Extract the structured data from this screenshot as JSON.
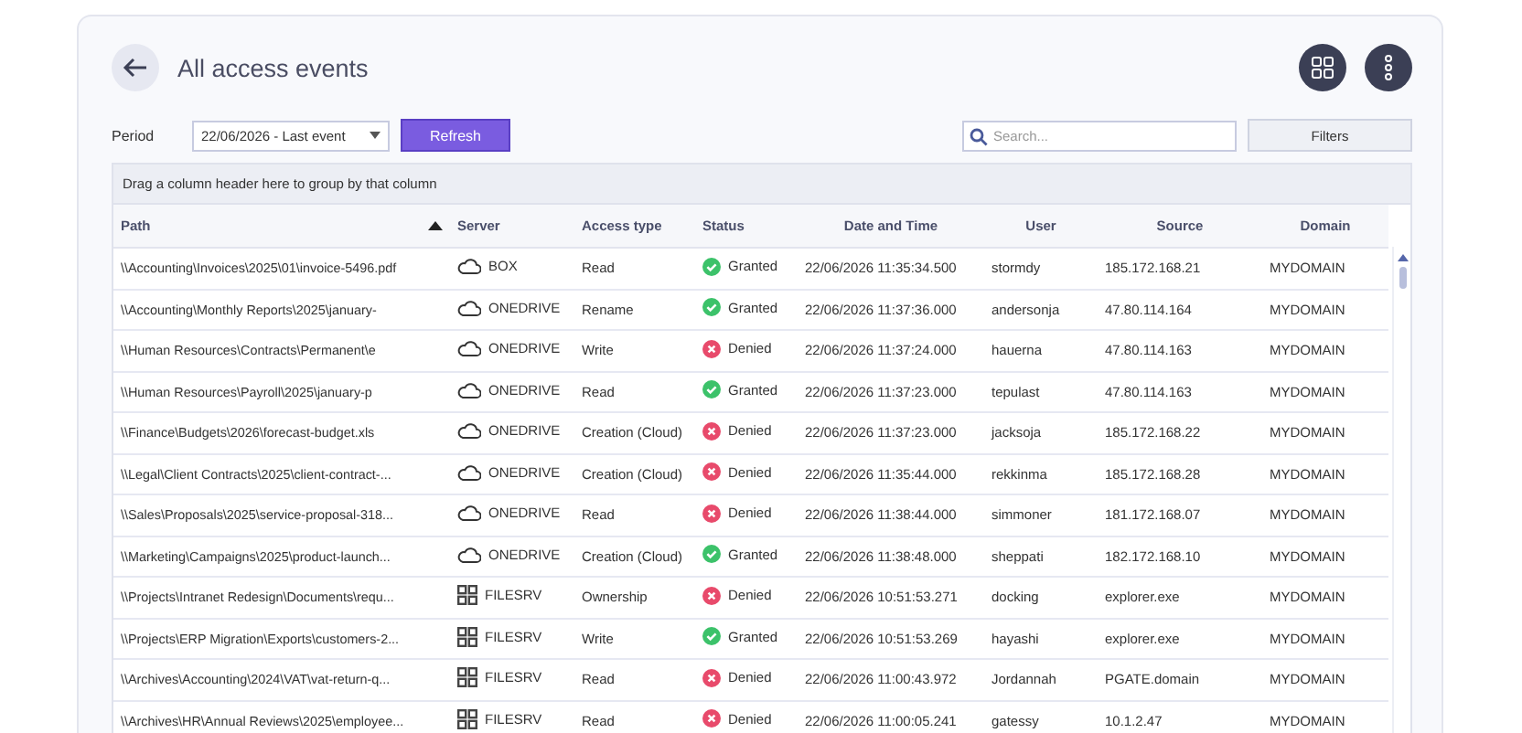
{
  "header": {
    "title": "All access events"
  },
  "toolbar": {
    "period_label": "Period",
    "period_value": "22/06/2026 - Last event",
    "refresh": "Refresh",
    "search_placeholder": "Search...",
    "filters": "Filters"
  },
  "group_hint": "Drag a column header here to group by that column",
  "table": {
    "columns": [
      {
        "label": "Path",
        "sorted": true
      },
      {
        "label": "Server",
        "sorted": false
      },
      {
        "label": "Access type",
        "sorted": false
      },
      {
        "label": "Status",
        "sorted": false
      },
      {
        "label": "Date and Time",
        "sorted": false
      },
      {
        "label": "User",
        "sorted": false
      },
      {
        "label": "Source",
        "sorted": false
      },
      {
        "label": "Domain",
        "sorted": false
      }
    ],
    "rows": [
      {
        "path": "\\\\Accounting\\Invoices\\2025\\01\\invoice-5496.pdf",
        "cloud": true,
        "server": "BOX",
        "access": "Read",
        "granted": true,
        "status": "Granted",
        "time": "22/06/2026 11:35:34.500",
        "user": "stormdy",
        "source": "185.172.168.21",
        "domain": "MYDOMAIN"
      },
      {
        "path": "\\\\Accounting\\Monthly Reports\\2025\\january-",
        "cloud": true,
        "server": "ONEDRIVE",
        "access": "Rename",
        "granted": true,
        "status": "Granted",
        "time": "22/06/2026 11:37:36.000",
        "user": "andersonja",
        "source": "47.80.114.164",
        "domain": "MYDOMAIN"
      },
      {
        "path": "\\\\Human Resources\\Contracts\\Permanent\\e",
        "cloud": true,
        "server": "ONEDRIVE",
        "access": "Write",
        "granted": false,
        "status": "Denied",
        "time": "22/06/2026 11:37:24.000",
        "user": "hauerna",
        "source": "47.80.114.163",
        "domain": "MYDOMAIN"
      },
      {
        "path": "\\\\Human Resources\\Payroll\\2025\\january-p",
        "cloud": true,
        "server": "ONEDRIVE",
        "access": "Read",
        "granted": true,
        "status": "Granted",
        "time": "22/06/2026 11:37:23.000",
        "user": "tepulast",
        "source": "47.80.114.163",
        "domain": "MYDOMAIN"
      },
      {
        "path": "\\\\Finance\\Budgets\\2026\\forecast-budget.xls",
        "cloud": true,
        "server": "ONEDRIVE",
        "access": "Creation (Cloud)",
        "granted": false,
        "status": "Denied",
        "time": "22/06/2026 11:37:23.000",
        "user": "jacksoja",
        "source": "185.172.168.22",
        "domain": "MYDOMAIN"
      },
      {
        "path": "\\\\Legal\\Client Contracts\\2025\\client-contract-...",
        "cloud": true,
        "server": "ONEDRIVE",
        "access": "Creation (Cloud)",
        "granted": false,
        "status": "Denied",
        "time": "22/06/2026 11:35:44.000",
        "user": "rekkinma",
        "source": "185.172.168.28",
        "domain": "MYDOMAIN"
      },
      {
        "path": "\\\\Sales\\Proposals\\2025\\service-proposal-318...",
        "cloud": true,
        "server": "ONEDRIVE",
        "access": "Read",
        "granted": false,
        "status": "Denied",
        "time": "22/06/2026 11:38:44.000",
        "user": "simmoner",
        "source": "181.172.168.07",
        "domain": "MYDOMAIN"
      },
      {
        "path": "\\\\Marketing\\Campaigns\\2025\\product-launch...",
        "cloud": true,
        "server": "ONEDRIVE",
        "access": "Creation (Cloud)",
        "granted": true,
        "status": "Granted",
        "time": "22/06/2026 11:38:48.000",
        "user": "sheppati",
        "source": "182.172.168.10",
        "domain": "MYDOMAIN"
      },
      {
        "path": "\\\\Projects\\Intranet Redesign\\Documents\\requ...",
        "cloud": false,
        "server": "FILESRV",
        "access": "Ownership",
        "granted": false,
        "status": "Denied",
        "time": "22/06/2026 10:51:53.271",
        "user": "docking",
        "source": "explorer.exe",
        "domain": "MYDOMAIN"
      },
      {
        "path": "\\\\Projects\\ERP Migration\\Exports\\customers-2...",
        "cloud": false,
        "server": "FILESRV",
        "access": "Write",
        "granted": true,
        "status": "Granted",
        "time": "22/06/2026 10:51:53.269",
        "user": "hayashi",
        "source": "explorer.exe",
        "domain": "MYDOMAIN"
      },
      {
        "path": "\\\\Archives\\Accounting\\2024\\VAT\\vat-return-q...",
        "cloud": false,
        "server": "FILESRV",
        "access": "Read",
        "granted": false,
        "status": "Denied",
        "time": "22/06/2026 11:00:43.972",
        "user": "Jordannah",
        "source": "PGATE.domain",
        "domain": "MYDOMAIN"
      },
      {
        "path": "\\\\Archives\\HR\\Annual Reviews\\2025\\employee...",
        "cloud": false,
        "server": "FILESRV",
        "access": "Read",
        "granted": false,
        "status": "Denied",
        "time": "22/06/2026 11:00:05.241",
        "user": "gatessy",
        "source": "10.1.2.47",
        "domain": "MYDOMAIN"
      }
    ]
  }
}
